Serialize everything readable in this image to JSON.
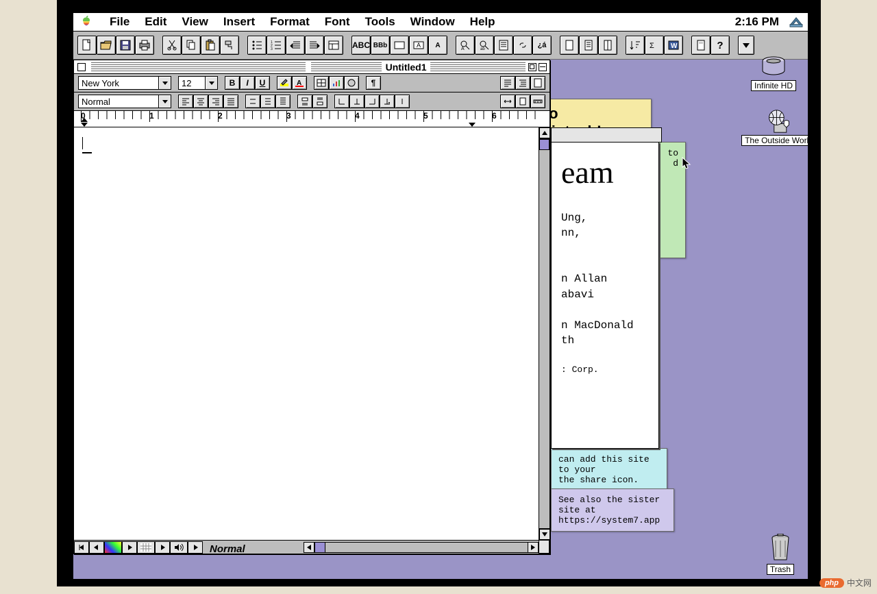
{
  "menubar": {
    "items": [
      "File",
      "Edit",
      "View",
      "Insert",
      "Format",
      "Font",
      "Tools",
      "Window",
      "Help"
    ],
    "clock": "2:16 PM"
  },
  "doc": {
    "title": "Untitled1",
    "font_name": "New York",
    "font_size": "12",
    "style_name": "Normal",
    "ruler_labels": [
      "0",
      "1",
      "2",
      "3",
      "4",
      "5",
      "6"
    ],
    "status_style": "Normal"
  },
  "desktop_icons": {
    "hd": "Infinite HD",
    "world": "The Outside World",
    "trash": "Trash"
  },
  "notes": {
    "yellow_line1": "ne to",
    "yellow_line2": "Macintosh!",
    "green_line1": "to",
    "green_line2": "d",
    "cyan_line1": "can add this site to your",
    "cyan_line2": "the share icon.",
    "lav_line1": "See also the sister site at",
    "lav_line2": "https://system7.app"
  },
  "about": {
    "heading_fragment": "eam",
    "l1": "Ung,",
    "l2": "nn,",
    "l3": "n Allan",
    "l4": "abavi",
    "l5": "n MacDonald",
    "l6": "th",
    "l7": ": Corp."
  },
  "badge": {
    "pill": "php",
    "cn": "中文网"
  }
}
